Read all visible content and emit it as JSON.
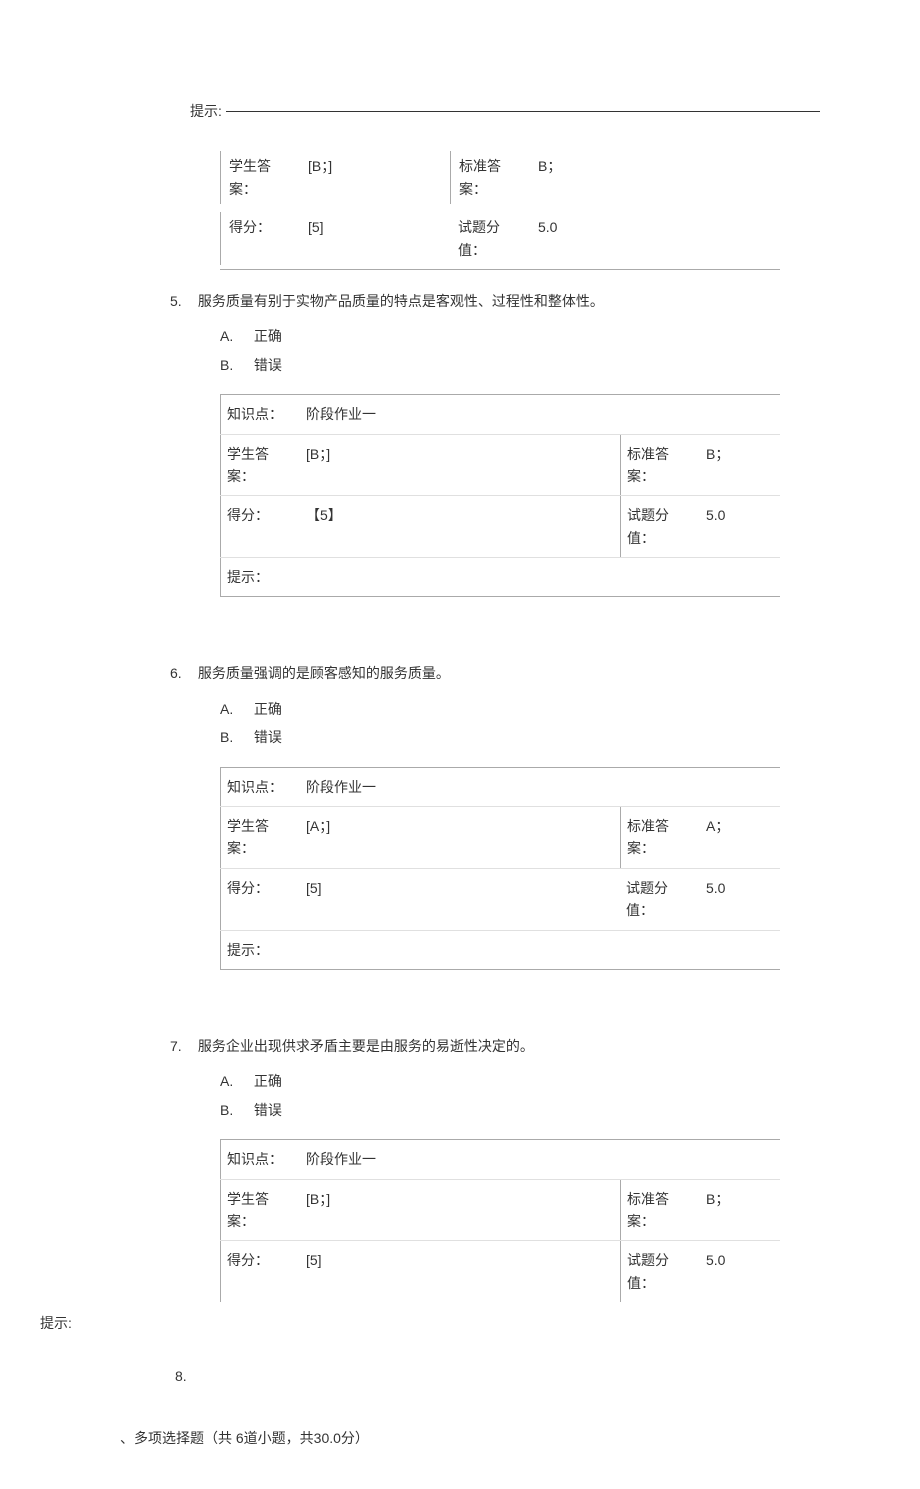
{
  "labels": {
    "hint": "提示:",
    "student_answer": "学生答案：",
    "correct_answer": "标准答案：",
    "score": "得分：",
    "question_value": "试题分值：",
    "knowledge_point": "知识点：",
    "hint_colon": "提示："
  },
  "common": {
    "kp_value": "阶段作业一",
    "option_a_letter": "A.",
    "option_b_letter": "B.",
    "option_correct": "正确",
    "option_wrong": "错误"
  },
  "q4_partial": {
    "student_answer": "[B；]",
    "correct_answer": "B；",
    "score": "[5]",
    "value": "5.0"
  },
  "q5": {
    "num": "5.",
    "text": "服务质量有别于实物产品质量的特点是客观性、过程性和整体性。",
    "student_answer": "[B；]",
    "correct_answer": "B；",
    "score": "【5】",
    "value": "5.0"
  },
  "q6": {
    "num": "6.",
    "text": "服务质量强调的是顾客感知的服务质量。",
    "student_answer": "[A；]",
    "correct_answer": "A；",
    "score": "[5]",
    "value": "5.0"
  },
  "q7": {
    "num": "7.",
    "text": "服务企业出现供求矛盾主要是由服务的易逝性决定的。",
    "student_answer": "[B；]",
    "correct_answer": "B；",
    "score": "[5]",
    "value": "5.0"
  },
  "q8": {
    "num": "8."
  },
  "section": {
    "title": "、多项选择题（共 6道小题，共30.0分）"
  }
}
